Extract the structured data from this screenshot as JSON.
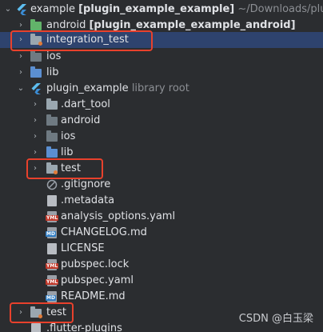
{
  "colors": {
    "background": "#2b2d30",
    "selection": "#2e436e",
    "highlight": "#e8412c",
    "muted": "#8c8f94"
  },
  "tree": {
    "root": {
      "name": "example",
      "module": "[plugin_example_example]",
      "path": "~/Downloads/plugir"
    },
    "items": {
      "android_module": {
        "name": "android",
        "module": "[plugin_example_example_android]"
      },
      "integration_test": {
        "name": "integration_test"
      },
      "ios": {
        "name": "ios"
      },
      "lib": {
        "name": "lib"
      },
      "plugin_example": {
        "name": "plugin_example",
        "hint": "library root"
      },
      "dart_tool": {
        "name": ".dart_tool"
      },
      "android": {
        "name": "android"
      },
      "ios2": {
        "name": "ios"
      },
      "lib2": {
        "name": "lib"
      },
      "test_inner": {
        "name": "test"
      },
      "gitignore": {
        "name": ".gitignore"
      },
      "metadata": {
        "name": ".metadata"
      },
      "analysis": {
        "name": "analysis_options.yaml",
        "tag": "YML"
      },
      "changelog": {
        "name": "CHANGELOG.md",
        "tag": "MD"
      },
      "license": {
        "name": "LICENSE"
      },
      "pubspec_lock": {
        "name": "pubspec.lock",
        "tag": "YML"
      },
      "pubspec_yaml": {
        "name": "pubspec.yaml",
        "tag": "YML"
      },
      "readme": {
        "name": "README.md",
        "tag": "MD"
      },
      "test_outer": {
        "name": "test"
      },
      "flutter_plugins": {
        "name": ".flutter-plugins"
      }
    }
  },
  "watermark": "CSDN @白玉梁"
}
